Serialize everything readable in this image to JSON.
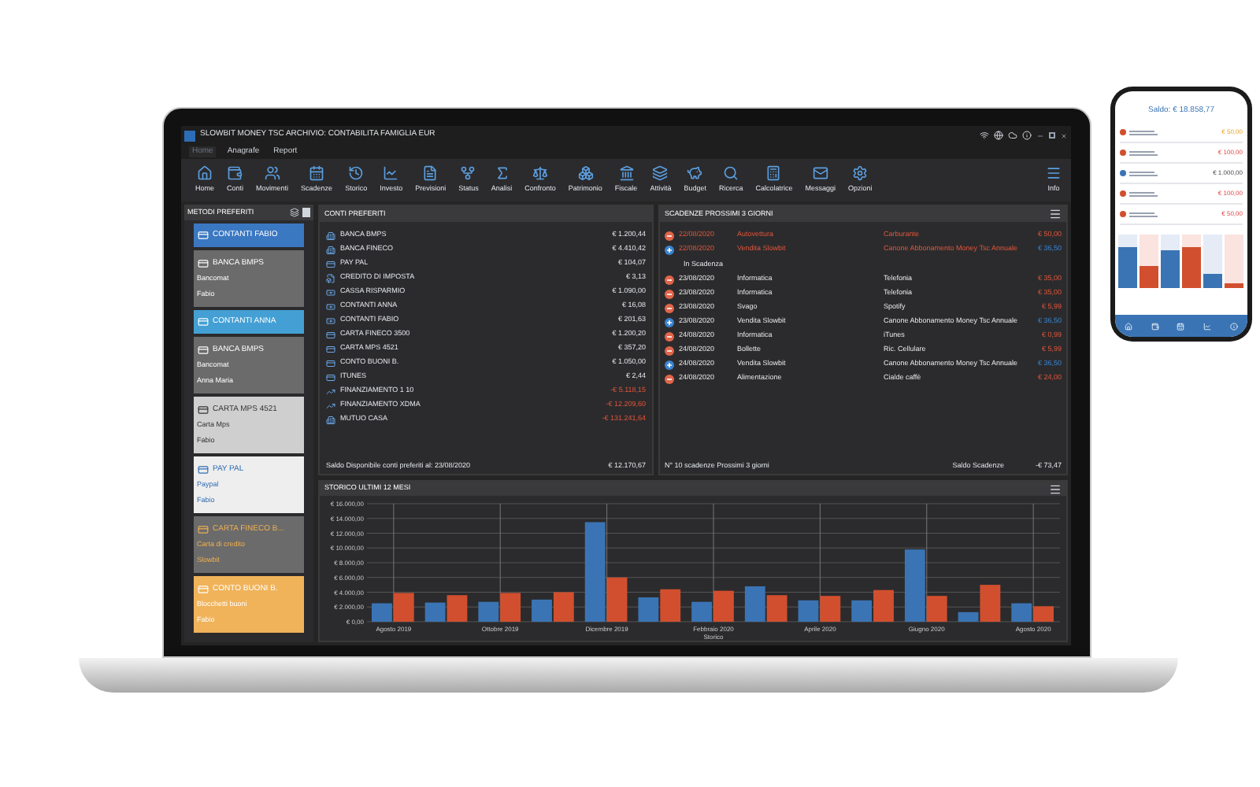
{
  "window": {
    "title": "SLOWBIT MONEY TSC ARCHIVIO: CONTABILITA FAMIGLIA EUR"
  },
  "menu": [
    {
      "label": "Home",
      "selected": true
    },
    {
      "label": "Anagrafe",
      "selected": false
    },
    {
      "label": "Report",
      "selected": false
    }
  ],
  "toolbar": [
    "Home",
    "Conti",
    "Movimenti",
    "Scadenze",
    "Storico",
    "Investo",
    "Previsioni",
    "Status",
    "Analisi",
    "Confronto",
    "Patrimonio",
    "Fiscale",
    "Attività",
    "Budget",
    "Ricerca",
    "Calcolatrice",
    "Messaggi",
    "Opzioni"
  ],
  "toolbar_right": "Info",
  "sidebar": {
    "title": "METODI PREFERITI",
    "cards": [
      {
        "name": "CONTANTI FABIO",
        "color": "#3b78c2",
        "kind": "plain"
      },
      {
        "name": "BANCA BMPS",
        "type": "Bancomat",
        "owner": "Fabio",
        "color": "#6b6b6b",
        "kind": "plain"
      },
      {
        "name": "CONTANTI ANNA",
        "color": "#44a0d4",
        "kind": "plain"
      },
      {
        "name": "BANCA BMPS",
        "type": "Bancomat",
        "owner": "Anna Maria",
        "color": "#6b6b6b",
        "kind": "plain"
      },
      {
        "name": "CARTA MPS 4521",
        "type": "Carta Mps",
        "owner": "Fabio",
        "color": "#cfcfcf",
        "kind": "dark"
      },
      {
        "name": "PAY PAL",
        "type": "Paypal",
        "owner": "Fabio",
        "color": "#eeeeee",
        "kind": "link"
      },
      {
        "name": "CARTA FINECO B...",
        "type": "Carta di credito",
        "owner": "Slowbit",
        "color": "#6b6b6b",
        "kind": "accent"
      },
      {
        "name": "CONTO BUONI B.",
        "type": "Blocchetti buoni",
        "owner": "Fabio",
        "color": "#f0b35a",
        "kind": "plain"
      }
    ]
  },
  "accounts": {
    "title": "CONTI PREFERITI",
    "rows": [
      {
        "kind": "bank",
        "name": "BANCA BMPS",
        "amount": "€ 1.200,44",
        "negative": false
      },
      {
        "kind": "bank",
        "name": "BANCA FINECO",
        "amount": "€ 4.410,42",
        "negative": false
      },
      {
        "kind": "card",
        "name": "PAY PAL",
        "amount": "€ 104,07",
        "negative": false
      },
      {
        "kind": "doc",
        "name": "CREDITO DI IMPOSTA",
        "amount": "€ 3,13",
        "negative": false
      },
      {
        "kind": "cash",
        "name": "CASSA RISPARMIO",
        "amount": "€ 1.090,00",
        "negative": false
      },
      {
        "kind": "cash",
        "name": "CONTANTI ANNA",
        "amount": "€ 16,08",
        "negative": false
      },
      {
        "kind": "cash",
        "name": "CONTANTI FABIO",
        "amount": "€ 201,63",
        "negative": false
      },
      {
        "kind": "card",
        "name": "CARTA FINECO 3500",
        "amount": "€ 1.200,20",
        "negative": false
      },
      {
        "kind": "card",
        "name": "CARTA MPS 4521",
        "amount": "€ 357,20",
        "negative": false
      },
      {
        "kind": "card",
        "name": "CONTO BUONI B.",
        "amount": "€ 1.050,00",
        "negative": false
      },
      {
        "kind": "card",
        "name": "ITUNES",
        "amount": "€ 2,44",
        "negative": false
      },
      {
        "kind": "loan",
        "name": "FINANZIAMENTO 1 10",
        "amount": "-€ 5.118,15",
        "negative": true
      },
      {
        "kind": "loan",
        "name": "FINANZIAMENTO XDMA",
        "amount": "-€ 12.209,60",
        "negative": true
      },
      {
        "kind": "bank",
        "name": "MUTUO CASA",
        "amount": "-€ 131.241,64",
        "negative": true
      }
    ],
    "footer_label": "Saldo Disponibile conti preferiti al:  23/08/2020",
    "footer_amount": "€ 12.170,67"
  },
  "deadlines": {
    "title": "SCADENZE PROSSIMI 3 GIORNI",
    "overdue": [
      {
        "kind": "expense",
        "date": "22/08/2020",
        "category": "Autovettura",
        "description": "Carburante",
        "amount": "€ 50,00"
      },
      {
        "kind": "income",
        "date": "22/08/2020",
        "category": "Vendita Slowbit",
        "description": "Canone Abbonamento Money Tsc Annuale",
        "amount": "€ 36,50"
      }
    ],
    "section": "In Scadenza",
    "upcoming": [
      {
        "kind": "expense",
        "date": "23/08/2020",
        "category": "Informatica",
        "description": "Telefonia",
        "amount": "€ 35,00"
      },
      {
        "kind": "expense",
        "date": "23/08/2020",
        "category": "Informatica",
        "description": "Telefonia",
        "amount": "€ 35,00"
      },
      {
        "kind": "expense",
        "date": "23/08/2020",
        "category": "Svago",
        "description": "Spotify",
        "amount": "€ 5,99"
      },
      {
        "kind": "income",
        "date": "23/08/2020",
        "category": "Vendita Slowbit",
        "description": "Canone Abbonamento Money Tsc Annuale",
        "amount": "€ 36,50"
      },
      {
        "kind": "expense",
        "date": "24/08/2020",
        "category": "Informatica",
        "description": "iTunes",
        "amount": "€ 0,99"
      },
      {
        "kind": "expense",
        "date": "24/08/2020",
        "category": "Bollette",
        "description": "Ric. Cellulare",
        "amount": "€ 5,99"
      },
      {
        "kind": "income",
        "date": "24/08/2020",
        "category": "Vendita Slowbit",
        "description": "Canone Abbonamento Money Tsc Annuale",
        "amount": "€ 36,50"
      },
      {
        "kind": "expense",
        "date": "24/08/2020",
        "category": "Alimentazione",
        "description": "Cialde caffè",
        "amount": "€ 24,00"
      }
    ],
    "footer_count": "N° 10 scadenze Prossimi 3 giorni",
    "footer_label": "Saldo Scadenze",
    "footer_amount": "-€ 73,47"
  },
  "history": {
    "title": "STORICO ULTIMI 12 MESI",
    "chart_data": {
      "type": "bar",
      "xlabel": "Storico",
      "grid": true,
      "categories": [
        "Agosto 2019",
        null,
        "Ottobre 2019",
        null,
        "Dicembre 2019",
        null,
        "Febbraio 2020",
        null,
        "Aprile 2020",
        null,
        "Giugno 2020",
        null,
        "Agosto 2020"
      ],
      "series": [
        {
          "color": "#3a74b4",
          "values": [
            2500,
            2600,
            2700,
            3000,
            13500,
            3300,
            2700,
            4800,
            2900,
            2900,
            9800,
            1300,
            2500
          ]
        },
        {
          "color": "#d14f2e",
          "values": [
            3900,
            3600,
            3900,
            4000,
            6000,
            4400,
            4200,
            3600,
            3500,
            4300,
            3500,
            5000,
            2100
          ]
        }
      ],
      "ylim": [
        0,
        16000
      ],
      "yticks": [
        {
          "value": 0,
          "label": "€ 0,00"
        },
        {
          "value": 2000,
          "label": "€ 2.000,00"
        },
        {
          "value": 4000,
          "label": "€ 4.000,00"
        },
        {
          "value": 6000,
          "label": "€ 6.000,00"
        },
        {
          "value": 8000,
          "label": "€ 8.000,00"
        },
        {
          "value": 10000,
          "label": "€ 10.000,00"
        },
        {
          "value": 12000,
          "label": "€ 12.000,00"
        },
        {
          "value": 14000,
          "label": "€ 14.000,00"
        },
        {
          "value": 16000,
          "label": "€ 16.000,00"
        }
      ]
    }
  },
  "phone": {
    "title": "Saldo: € 18.858,77",
    "rows": [
      {
        "kind": "pending",
        "amount": "€ 50,00"
      },
      {
        "kind": "expense",
        "amount": "€ 100,00"
      },
      {
        "kind": "income",
        "amount": "€ 1.000,00"
      },
      {
        "kind": "expense",
        "amount": "€ 100,00"
      },
      {
        "kind": "expense",
        "amount": "€ 50,00"
      }
    ]
  }
}
